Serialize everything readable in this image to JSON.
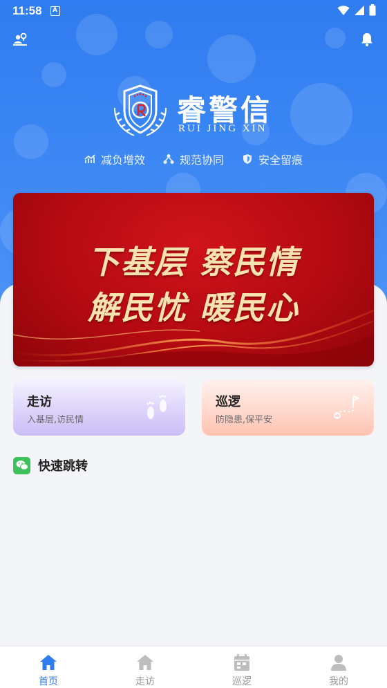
{
  "status_bar": {
    "time": "11:58",
    "notif_badge": "A"
  },
  "header": {
    "logo_title": "睿警信",
    "logo_subtitle": "RUI JING XIN",
    "slogans": [
      {
        "label": "减负增效",
        "icon": "chart-icon"
      },
      {
        "label": "规范协同",
        "icon": "network-icon"
      },
      {
        "label": "安全留痕",
        "icon": "shield-icon"
      }
    ]
  },
  "banner": {
    "line1": "下基层 察民情",
    "line2": "解民忧 暖民心"
  },
  "cards": {
    "visit": {
      "title": "走访",
      "subtitle": "入基层,访民情",
      "icon": "footprints-icon"
    },
    "patrol": {
      "title": "巡逻",
      "subtitle": "防隐患,保平安",
      "icon": "route-flag-icon"
    }
  },
  "quick_jump": {
    "title": "快速跳转"
  },
  "bottom_nav": {
    "items": [
      {
        "label": "首页",
        "icon": "home-icon",
        "active": true
      },
      {
        "label": "走访",
        "icon": "home-icon",
        "active": false
      },
      {
        "label": "巡逻",
        "icon": "calendar-icon",
        "active": false
      },
      {
        "label": "我的",
        "icon": "user-icon",
        "active": false
      }
    ]
  },
  "colors": {
    "primary": "#2f7cf0",
    "nav_inactive": "#999999",
    "banner_red": "#c10e15",
    "banner_text": "#f8e2b0"
  }
}
